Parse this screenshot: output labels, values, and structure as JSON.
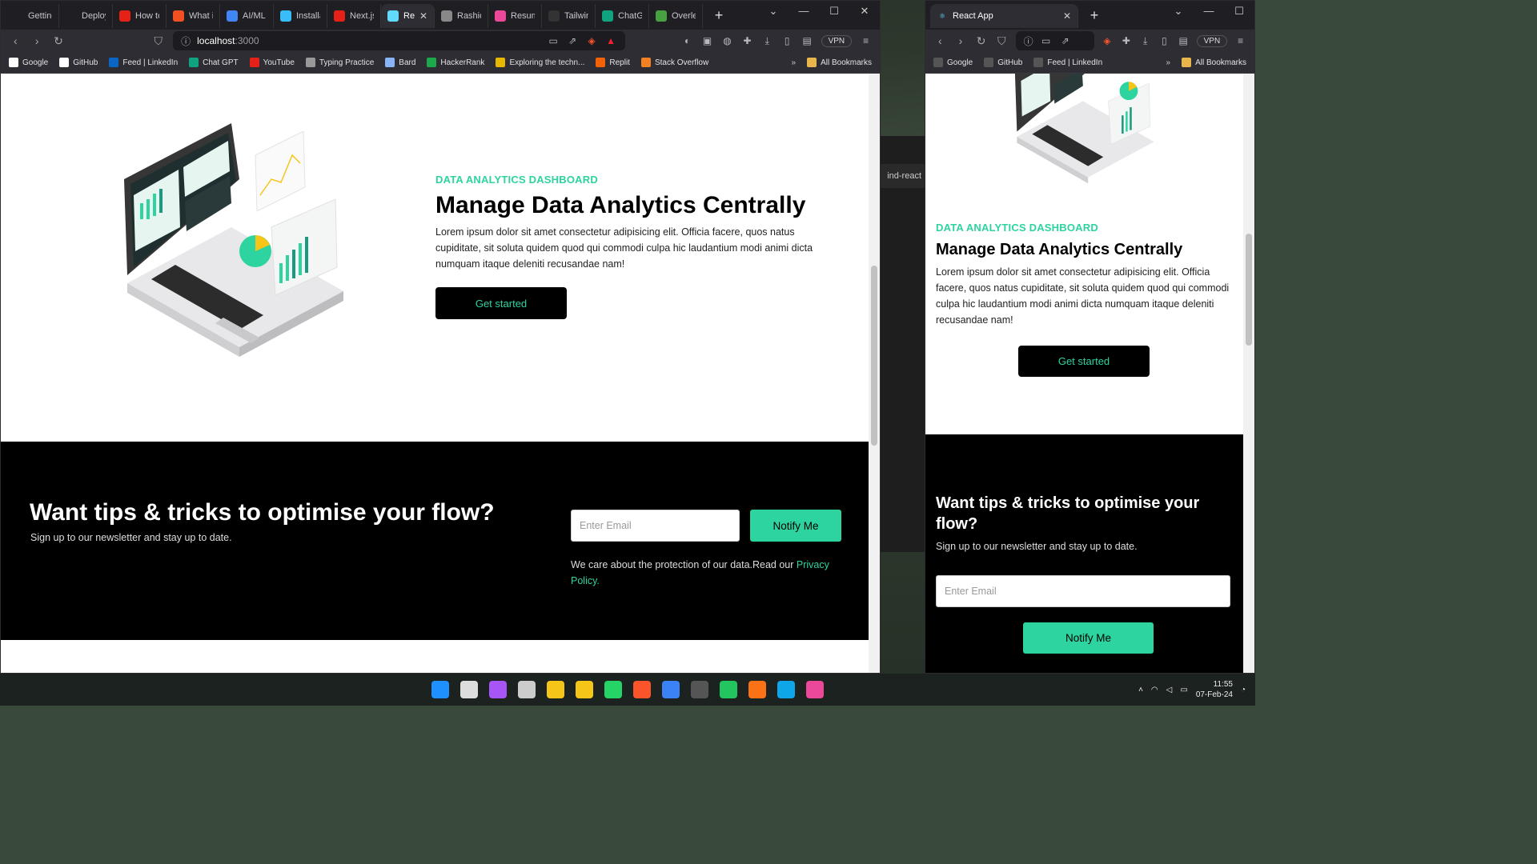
{
  "left_window": {
    "tabs": [
      {
        "label": "Getting S",
        "icon": "react-icon",
        "color": "#1f1f23"
      },
      {
        "label": "Deploym",
        "icon": "react-icon",
        "color": "#1f1f23"
      },
      {
        "label": "How to",
        "icon": "youtube-icon",
        "color": "#e62117"
      },
      {
        "label": "What is",
        "icon": "microsoft-icon",
        "color": "#f25022"
      },
      {
        "label": "AI/ML fr",
        "icon": "cloud-icon",
        "color": "#4285f4"
      },
      {
        "label": "Installati",
        "icon": "tailwind-icon",
        "color": "#38bdf8"
      },
      {
        "label": "Next.js,",
        "icon": "youtube-icon",
        "color": "#e62117"
      },
      {
        "label": "Rea",
        "icon": "react-icon",
        "color": "#61dafb",
        "active": true
      },
      {
        "label": "Rashid S",
        "icon": "profile-icon",
        "color": "#888"
      },
      {
        "label": "Resume",
        "icon": "resume-icon",
        "color": "#ec4899"
      },
      {
        "label": "Tailwind",
        "icon": "github-icon",
        "color": "#333"
      },
      {
        "label": "ChatGPT",
        "icon": "chatgpt-icon",
        "color": "#10a37f"
      },
      {
        "label": "Overleaf",
        "icon": "overleaf-icon",
        "color": "#47a141"
      }
    ],
    "url_host": "localhost",
    "url_port": ":3000",
    "vpn_label": "VPN",
    "bookmarks": [
      {
        "label": "Google",
        "icon": "google-icon",
        "color": "#fff"
      },
      {
        "label": "GitHub",
        "icon": "github-icon",
        "color": "#fff"
      },
      {
        "label": "Feed | LinkedIn",
        "icon": "linkedin-icon",
        "color": "#0a66c2"
      },
      {
        "label": "Chat GPT",
        "icon": "chatgpt-icon",
        "color": "#10a37f"
      },
      {
        "label": "YouTube",
        "icon": "youtube-icon",
        "color": "#e62117"
      },
      {
        "label": "Typing Practice",
        "icon": "typing-icon",
        "color": "#999"
      },
      {
        "label": "Bard",
        "icon": "bard-icon",
        "color": "#8ab4f8"
      },
      {
        "label": "HackerRank",
        "icon": "hackerrank-icon",
        "color": "#1ba94c"
      },
      {
        "label": "Exploring the techn...",
        "icon": "sh-icon",
        "color": "#e6b800"
      },
      {
        "label": "Replit",
        "icon": "replit-icon",
        "color": "#f26207"
      },
      {
        "label": "Stack Overflow",
        "icon": "stackoverflow-icon",
        "color": "#f48024"
      }
    ],
    "all_bookmarks": "All Bookmarks"
  },
  "right_window": {
    "tab_label": "React App",
    "bookmarks": [
      {
        "label": "Google",
        "icon": "google-icon"
      },
      {
        "label": "GitHub",
        "icon": "github-icon"
      },
      {
        "label": "Feed | LinkedIn",
        "icon": "linkedin-icon"
      }
    ],
    "all_bookmarks": "All Bookmarks",
    "vpn_label": "VPN"
  },
  "hero": {
    "eyebrow": "DATA ANALYTICS DASHBOARD",
    "title": "Manage Data Analytics Centrally",
    "body": "Lorem ipsum dolor sit amet consectetur adipisicing elit. Officia facere, quos natus cupiditate, sit soluta quidem quod qui commodi culpa hic laudantium modi animi dicta numquam itaque deleniti recusandae nam!",
    "cta": "Get started"
  },
  "newsletter": {
    "title": "Want tips & tricks to optimise your flow?",
    "subtitle": "Sign up to our newsletter and stay up to date.",
    "email_placeholder": "Enter Email",
    "button": "Notify Me",
    "privacy_text": "We care about the protection of our data.Read our ",
    "privacy_link": "Privacy Policy."
  },
  "behind_window": {
    "label": "ind-react"
  },
  "taskbar": {
    "apps": [
      "windows-start-icon",
      "search-icon",
      "copilot-icon",
      "task-view-icon",
      "chrome-icon",
      "file-explorer-icon",
      "whatsapp-icon",
      "brave-icon",
      "vscode-icon",
      "terminal-icon",
      "paint-icon",
      "xampp-icon",
      "edge-icon",
      "jetbrains-icon"
    ],
    "time": "11:55",
    "date": "07-Feb-24"
  },
  "colors": {
    "accent": "#2dd4a0",
    "hero_bg": "#ffffff",
    "newsletter_bg": "#000000"
  }
}
